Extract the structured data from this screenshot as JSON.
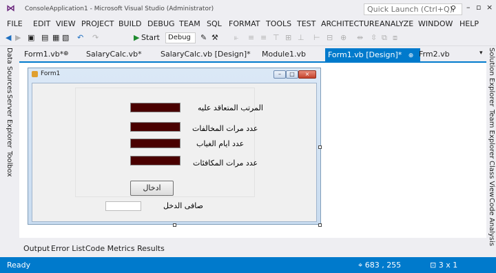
{
  "window": {
    "title": "ConsoleApplication1 - Microsoft Visual Studio (Administrator)",
    "quick_launch_placeholder": "Quick Launch (Ctrl+Q)",
    "minimize": "–",
    "restore": "▫",
    "close": "×"
  },
  "menu": [
    "FILE",
    "EDIT",
    "VIEW",
    "PROJECT",
    "BUILD",
    "DEBUG",
    "TEAM",
    "SQL",
    "FORMAT",
    "TOOLS",
    "TEST",
    "ARCHITECTURE",
    "ANALYZE",
    "WINDOW",
    "HELP"
  ],
  "toolbar": {
    "start_label": "Start",
    "config_value": "Debug"
  },
  "left_panels": [
    "Data Sources",
    "Server Explorer",
    "Toolbox"
  ],
  "right_panels": [
    "Solution Explorer",
    "Team Explorer",
    "Class View",
    "Code Analysis"
  ],
  "doc_tabs": [
    {
      "label": "Form1.vb*",
      "active": false
    },
    {
      "label": "SalaryCalc.vb*",
      "active": false
    },
    {
      "label": "SalaryCalc.vb [Design]*",
      "active": false
    },
    {
      "label": "Module1.vb",
      "active": false
    },
    {
      "label": "Form1.vb [Design]*",
      "active": true
    },
    {
      "label": "Frm2.vb",
      "active": false
    }
  ],
  "form": {
    "title": "Form1",
    "labels": {
      "contract_salary": "المرتب المتعاقد عليه",
      "violations": "عدد مرات المخالفات",
      "absence_days": "عدد ايام الغياب",
      "rewards": "عدد  مرات المكافئات",
      "net_income": "صافى الدخل"
    },
    "enter_button": "ادخال"
  },
  "bottom_tabs": [
    "Output",
    "Error List",
    "Code Metrics Results"
  ],
  "status": {
    "text": "Ready",
    "position": "683 , 255",
    "size": "3 x 1"
  },
  "colors": {
    "accent": "#007acc",
    "textbox_fill": "#4a0000"
  }
}
